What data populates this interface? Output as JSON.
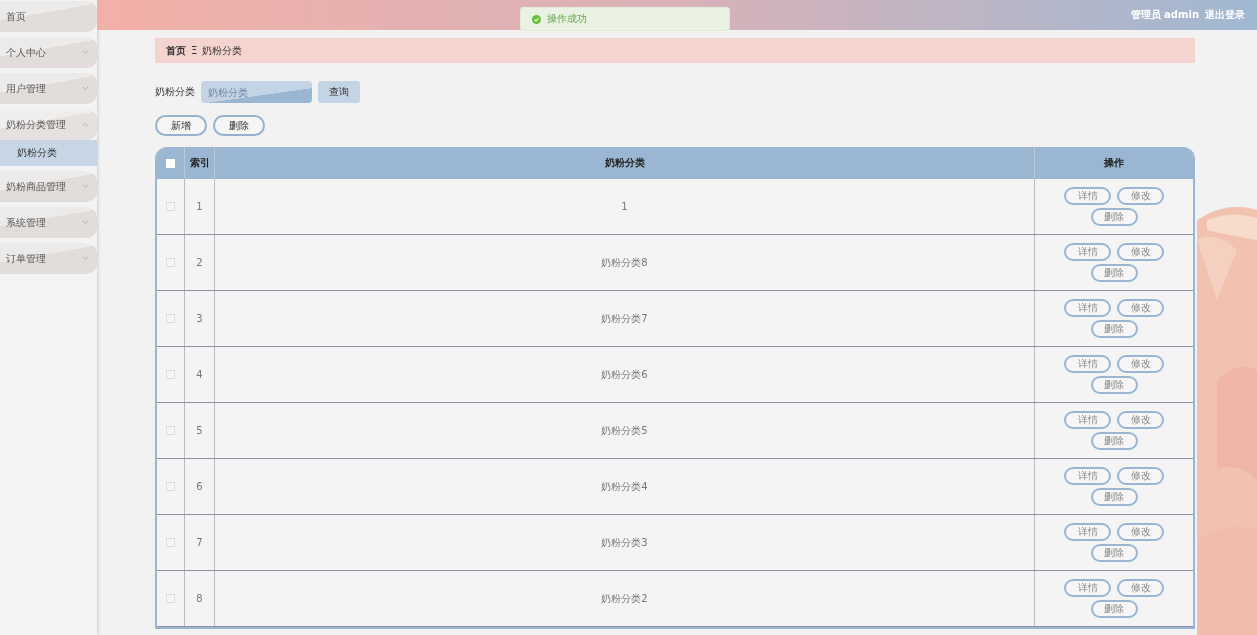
{
  "sidebar": {
    "items": [
      {
        "label": "首页"
      },
      {
        "label": "个人中心",
        "expanded": false
      },
      {
        "label": "用户管理",
        "expanded": false
      },
      {
        "label": "奶粉分类管理",
        "expanded": true,
        "children": [
          {
            "label": "奶粉分类",
            "selected": true
          }
        ]
      },
      {
        "label": "奶粉商品管理",
        "expanded": false
      },
      {
        "label": "系统管理",
        "expanded": false
      },
      {
        "label": "订单管理",
        "expanded": false
      }
    ]
  },
  "header": {
    "user": "管理员 admin",
    "logout": "退出登录"
  },
  "toast": {
    "message": "操作成功"
  },
  "breadcrumb": {
    "home": "首页",
    "separator": "Ξ",
    "current": "奶粉分类"
  },
  "search": {
    "label": "奶粉分类",
    "placeholder": "奶粉分类",
    "button": "查询"
  },
  "actions": [
    "新增",
    "删除"
  ],
  "table": {
    "columns": [
      "索引",
      "奶粉分类",
      "操作"
    ],
    "all_checked": false,
    "rows": [
      {
        "index": "1",
        "name": "1",
        "checked": false,
        "buttons": [
          "详情",
          "修改",
          "删除"
        ]
      },
      {
        "index": "2",
        "name": "奶粉分类8",
        "checked": false,
        "buttons": [
          "详情",
          "修改",
          "删除"
        ]
      },
      {
        "index": "3",
        "name": "奶粉分类7",
        "checked": false,
        "buttons": [
          "详情",
          "修改",
          "删除"
        ]
      },
      {
        "index": "4",
        "name": "奶粉分类6",
        "checked": false,
        "buttons": [
          "详情",
          "修改",
          "删除"
        ]
      },
      {
        "index": "5",
        "name": "奶粉分类5",
        "checked": false,
        "buttons": [
          "详情",
          "修改",
          "删除"
        ]
      },
      {
        "index": "6",
        "name": "奶粉分类4",
        "checked": false,
        "buttons": [
          "详情",
          "修改",
          "删除"
        ]
      },
      {
        "index": "7",
        "name": "奶粉分类3",
        "checked": false,
        "buttons": [
          "详情",
          "修改",
          "删除"
        ]
      },
      {
        "index": "8",
        "name": "奶粉分类2",
        "checked": false,
        "buttons": [
          "详情",
          "修改",
          "删除"
        ]
      }
    ]
  }
}
